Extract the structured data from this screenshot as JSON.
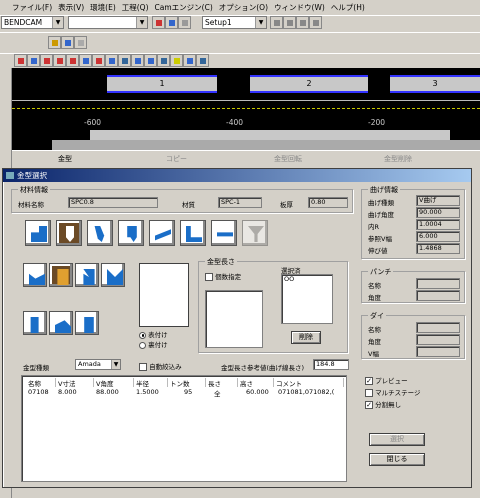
{
  "menu": [
    "ファイル(F)",
    "表示(V)",
    "環境(E)",
    "工程(Q)",
    "Camエンジン(C)",
    "オプション(O)",
    "ウィンドウ(W)",
    "ヘルプ(H)"
  ],
  "toolbar": {
    "machine_combo": "BENDCAM",
    "setup_combo": "Setup1"
  },
  "canvas": {
    "segments": [
      "1",
      "2",
      "3"
    ],
    "ruler": [
      "-600",
      "-400",
      "-200"
    ]
  },
  "tabs": [
    "金型",
    "コピー",
    "金型回転",
    "金型削除"
  ],
  "dialog": {
    "title": "金型選択",
    "material": {
      "group": "材料情報",
      "name_label": "材料名称",
      "name_value": "SPC0.8",
      "quality_label": "材質",
      "quality_value": "SPC-1",
      "thickness_label": "板厚",
      "thickness_value": "0.80"
    },
    "bend": {
      "group": "曲げ情報",
      "rows": [
        {
          "label": "曲げ種類",
          "value": "V曲げ"
        },
        {
          "label": "曲げ角度",
          "value": "90.000"
        },
        {
          "label": "内R",
          "value": "1.0004"
        },
        {
          "label": "参照V幅",
          "value": "6.000"
        },
        {
          "label": "伸び値",
          "value": "1.4868"
        }
      ]
    },
    "punch": {
      "group": "パンチ",
      "rows": [
        {
          "label": "名称"
        },
        {
          "label": "角度"
        }
      ]
    },
    "die": {
      "group": "ダイ",
      "rows": [
        {
          "label": "名称"
        },
        {
          "label": "角度"
        },
        {
          "label": "V幅"
        }
      ]
    },
    "length": {
      "group": "金型長さ",
      "specify_label": "個数指定",
      "selected_label": "選択済",
      "selected_value": "OO",
      "delete_button": "削除"
    },
    "radio": {
      "front": "表付け",
      "back": "裏付け"
    },
    "die_type_label": "金型種類",
    "die_type_value": "Amada",
    "auto_label": "自動絞込み",
    "ref_label": "金型長さ参考値(曲げ線長さ)",
    "ref_value": "184.8",
    "table": {
      "headers": [
        "名称",
        "V寸法",
        "V角度",
        "半径",
        "トン数",
        "長さ",
        "高さ",
        "コメント"
      ],
      "rows": [
        [
          "07108",
          "8.000",
          "88.000",
          "1.5000",
          "95",
          "全",
          "60.000",
          "071081,071082,("
        ]
      ]
    },
    "options": [
      {
        "label": "プレビュー",
        "checked": true
      },
      {
        "label": "マルチステージ",
        "checked": false
      },
      {
        "label": "分割無し",
        "checked": true
      }
    ],
    "select_button": "選択",
    "close_button": "閉じる"
  }
}
